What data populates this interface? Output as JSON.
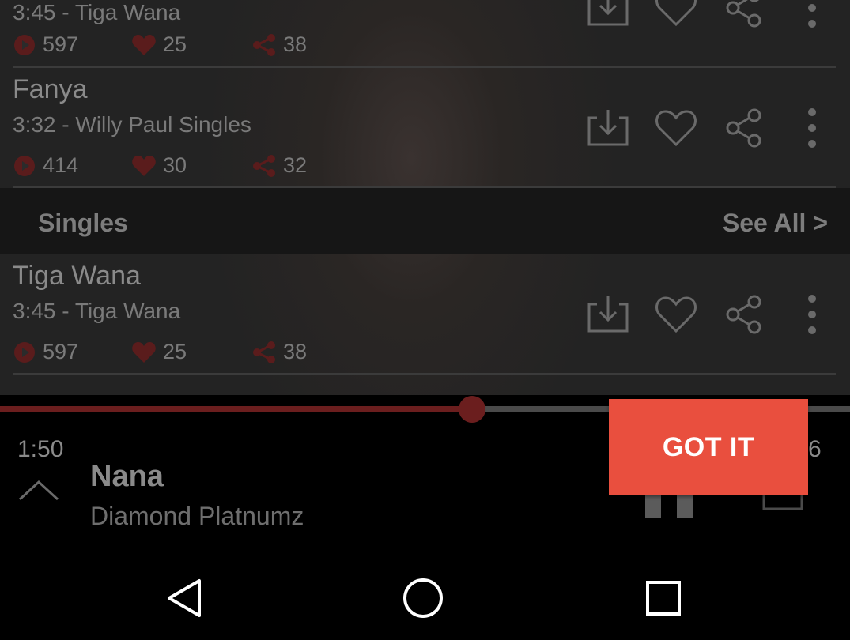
{
  "songs_top": [
    {
      "duration": "3:45",
      "separator": "-",
      "album": "Tiga Wana",
      "plays": "597",
      "likes": "25",
      "shares": "38"
    },
    {
      "title": "Fanya",
      "duration": "3:32",
      "separator": "-",
      "album": "Willy Paul Singles",
      "plays": "414",
      "likes": "30",
      "shares": "32"
    }
  ],
  "section": {
    "label": "Singles",
    "see_all": "See All >"
  },
  "songs_singles": [
    {
      "title": "Tiga Wana",
      "duration": "3:45",
      "separator": "-",
      "album": "Tiga Wana",
      "plays": "597",
      "likes": "25",
      "shares": "38"
    }
  ],
  "player": {
    "elapsed": "1:50",
    "total_fragment": "6",
    "title": "Nana",
    "artist": "Diamond Platnumz",
    "progress_fraction": 0.555
  },
  "tooltip": {
    "button_label": "GOT IT"
  },
  "colors": {
    "accent": "#e94f3e",
    "dim_red": "#6b1e1e",
    "background": "#000000"
  },
  "icons": {
    "download": "download-icon",
    "like": "heart-icon",
    "share": "share-icon",
    "more": "more-vert-icon",
    "play_count": "play-count-icon",
    "expand": "chevron-up-icon",
    "back": "nav-back-icon",
    "home": "nav-home-icon",
    "recents": "nav-recents-icon"
  }
}
